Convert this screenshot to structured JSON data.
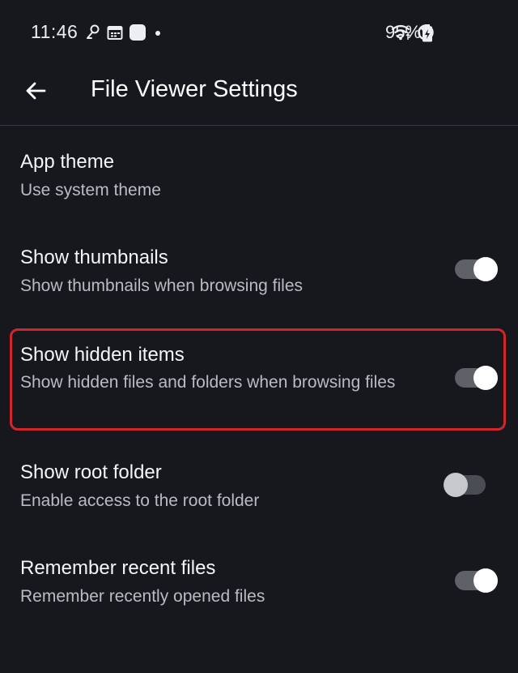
{
  "status_bar": {
    "time": "11:46",
    "battery_percent": "95%",
    "icons_left": [
      "assistant-icon",
      "calendar-icon",
      "app-icon",
      "dot-icon"
    ],
    "icons_right": [
      "wifi-icon",
      "do-not-disturb-icon",
      "battery-charging-icon"
    ]
  },
  "app_bar": {
    "title": "File Viewer Settings",
    "back_icon": "arrow-left-icon"
  },
  "settings": [
    {
      "title": "App theme",
      "subtitle": "Use system theme",
      "has_toggle": false
    },
    {
      "title": "Show thumbnails",
      "subtitle": "Show thumbnails when browsing files",
      "has_toggle": true,
      "toggle_on": true
    },
    {
      "title": "Show hidden items",
      "subtitle": "Show hidden files and folders when browsing files",
      "has_toggle": true,
      "toggle_on": true,
      "highlighted": true
    },
    {
      "title": "Show root folder",
      "subtitle": "Enable access to the root folder",
      "has_toggle": true,
      "toggle_on": false
    },
    {
      "title": "Remember recent files",
      "subtitle": "Remember recently opened files",
      "has_toggle": true,
      "toggle_on": true
    }
  ],
  "colors": {
    "background": "#16181d",
    "highlight": "#d0262b",
    "toggle_on_thumb": "#ffffff",
    "toggle_off_thumb": "#c6c8cc"
  }
}
